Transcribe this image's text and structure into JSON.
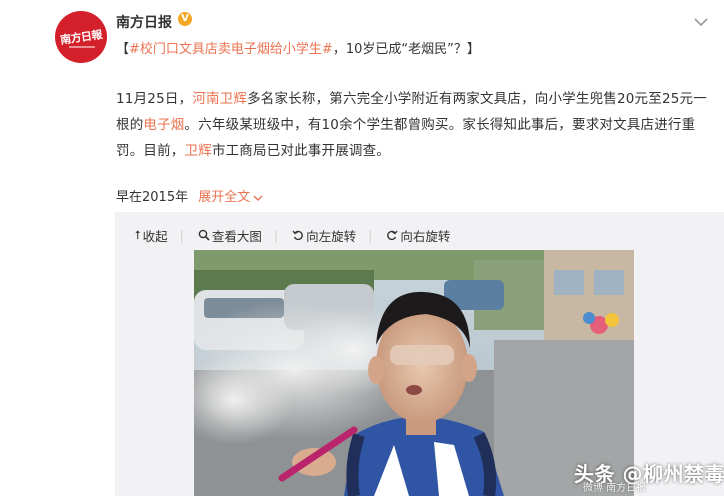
{
  "post": {
    "author": "南方日报",
    "avatar_text": "南方日報",
    "topic_prefix": "【",
    "topic": "#校门口文具店卖电子烟给小学生#",
    "topic_suffix": "，10岁已成",
    "quote": "“老烟民”？】",
    "body_lines": [
      {
        "a": "11月25日，",
        "b": "河南卫辉",
        "c": "多名家长称，第六完全小学附近有两家文具店，向小学生兜售20元至25元一"
      },
      {
        "a": "根的",
        "b": "电子烟",
        "c": "。六年级某班级中，有10余个学生都曾购买。家长得知此事后，要求对文具店进行重"
      },
      {
        "a": "罚。目前，",
        "b": "卫辉",
        "c": "市工商局已对此事开展调查。"
      }
    ],
    "time": "早在2015年",
    "expand": "展开全文",
    "expand_icon": "chevron-down-icon"
  },
  "toolbar": {
    "collapse": "收起",
    "view_large": "查看大图",
    "rotate_left": "向左旋转",
    "rotate_right": "向右旋转"
  },
  "watermark": {
    "main": "头条 @柳州禁毒",
    "sub": "微博 南方日报"
  },
  "colors": {
    "link": "#eb7350",
    "avatar": "#d4202a",
    "verified": "#f5a623",
    "panel_bg": "#f2f2f5"
  }
}
